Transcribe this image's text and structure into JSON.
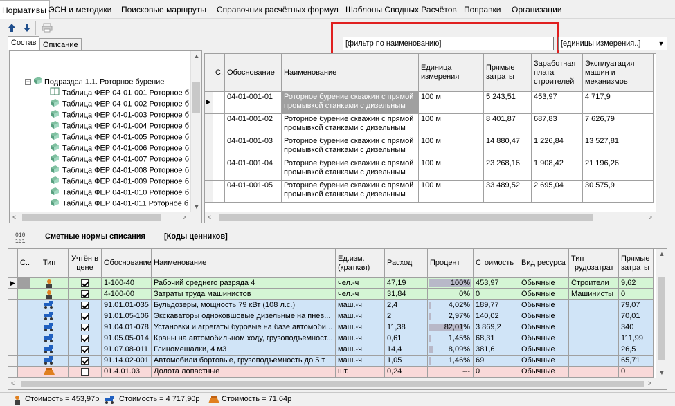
{
  "menu": {
    "tabs": [
      "Нормативы",
      "ЭСН и методики",
      "Поисковые маршруты",
      "Справочник расчётных формул",
      "Шаблоны Сводных Расчётов",
      "Поправки",
      "Организации"
    ]
  },
  "subtabs": [
    "Состав",
    "Описание"
  ],
  "filter": {
    "name_value": "[фильтр по наименованию]",
    "unit_value": "[единицы измерения..]"
  },
  "tree": {
    "root": "Подраздел 1.1. Роторное бурение",
    "items": [
      "Таблица ФЕР 04-01-001 Роторное б",
      "Таблица ФЕР 04-01-002 Роторное б",
      "Таблица ФЕР 04-01-003 Роторное б",
      "Таблица ФЕР 04-01-004 Роторное б",
      "Таблица ФЕР 04-01-005 Роторное б",
      "Таблица ФЕР 04-01-006 Роторное б",
      "Таблица ФЕР 04-01-007 Роторное б",
      "Таблица ФЕР 04-01-008 Роторное б",
      "Таблица ФЕР 04-01-009 Роторное б",
      "Таблица ФЕР 04-01-010 Роторное б",
      "Таблица ФЕР 04-01-011 Роторное б"
    ]
  },
  "upper_grid": {
    "headers": [
      "С..",
      "Обоснование",
      "Наименование",
      "Единица измерения",
      "Прямые затраты",
      "Заработная плата строителей",
      "Эксплуатация машин и механизмов"
    ],
    "rows": [
      {
        "code": "04-01-001-01",
        "name": "Роторное бурение скважин с прямой промывкой станками с дизельным",
        "unit": "100 м",
        "direct": "5 243,51",
        "salary": "453,97",
        "machines": "4 717,9"
      },
      {
        "code": "04-01-001-02",
        "name": "Роторное бурение скважин с прямой промывкой станками с дизельным",
        "unit": "100 м",
        "direct": "8 401,87",
        "salary": "687,83",
        "machines": "7 626,79"
      },
      {
        "code": "04-01-001-03",
        "name": "Роторное бурение скважин с прямой промывкой станками с дизельным",
        "unit": "100 м",
        "direct": "14 880,47",
        "salary": "1 226,84",
        "machines": "13 527,81"
      },
      {
        "code": "04-01-001-04",
        "name": "Роторное бурение скважин с прямой промывкой станками с дизельным",
        "unit": "100 м",
        "direct": "23 268,16",
        "salary": "1 908,42",
        "machines": "21 196,26"
      },
      {
        "code": "04-01-001-05",
        "name": "Роторное бурение скважин с прямой промывкой станками с дизельным",
        "unit": "100 м",
        "direct": "33 489,52",
        "salary": "2 695,04",
        "machines": "30 575,9"
      }
    ]
  },
  "lower_header": {
    "title": "Сметные нормы списания",
    "codes": "[Коды ценников]"
  },
  "lower_grid": {
    "headers": [
      "С..",
      "Тип",
      "Учтён в цене",
      "Обоснование",
      "Наименование",
      "Ед.изм. (краткая)",
      "Расход",
      "Процент",
      "Стоимость",
      "Вид ресурса",
      "Тип трудозатрат",
      "Прямые затраты"
    ],
    "rows": [
      {
        "icon": "worker",
        "checked": true,
        "code": "1-100-40",
        "name": "Рабочий среднего разряда 4",
        "unit": "чел.-ч",
        "rate": "47,19",
        "pct": "100%",
        "pct_fraction": 1.0,
        "cost": "453,97",
        "kind": "Обычные",
        "labor": "Строители",
        "direct": "9,62",
        "bg": "#d4f5d4"
      },
      {
        "icon": "worker",
        "checked": true,
        "code": "4-100-00",
        "name": "Затраты труда машинистов",
        "unit": "чел.-ч",
        "rate": "31,84",
        "pct": "0%",
        "pct_fraction": 0,
        "cost": "0",
        "kind": "Обычные",
        "labor": "Машинисты",
        "direct": "0",
        "bg": "#d4f5d4"
      },
      {
        "icon": "machine",
        "checked": true,
        "code": "91.01.01-035",
        "name": "Бульдозеры, мощность 79 кВт (108 л.с.)",
        "unit": "маш.-ч",
        "rate": "2,4",
        "pct": "4,02%",
        "pct_fraction": 0.0402,
        "cost": "189,77",
        "kind": "Обычные",
        "labor": "",
        "direct": "79,07",
        "bg": "#d0e4f7"
      },
      {
        "icon": "machine",
        "checked": true,
        "code": "91.01.05-106",
        "name": "Экскаваторы одноковшовые дизельные на пнев...",
        "unit": "маш.-ч",
        "rate": "2",
        "pct": "2,97%",
        "pct_fraction": 0.0297,
        "cost": "140,02",
        "kind": "Обычные",
        "labor": "",
        "direct": "70,01",
        "bg": "#d0e4f7"
      },
      {
        "icon": "machine",
        "checked": true,
        "code": "91.04.01-078",
        "name": "Установки и агрегаты буровые на базе автомоби...",
        "unit": "маш.-ч",
        "rate": "11,38",
        "pct": "82,01%",
        "pct_fraction": 0.8201,
        "cost": "3 869,2",
        "kind": "Обычные",
        "labor": "",
        "direct": "340",
        "bg": "#d0e4f7"
      },
      {
        "icon": "machine",
        "checked": true,
        "code": "91.05.05-014",
        "name": "Краны на автомобильном ходу, грузоподъемност...",
        "unit": "маш.-ч",
        "rate": "0,61",
        "pct": "1,45%",
        "pct_fraction": 0.0145,
        "cost": "68,31",
        "kind": "Обычные",
        "labor": "",
        "direct": "111,99",
        "bg": "#d0e4f7"
      },
      {
        "icon": "machine",
        "checked": true,
        "code": "91.07.08-011",
        "name": "Глиномешалки, 4 м3",
        "unit": "маш.-ч",
        "rate": "14,4",
        "pct": "8,09%",
        "pct_fraction": 0.0809,
        "cost": "381,6",
        "kind": "Обычные",
        "labor": "",
        "direct": "26,5",
        "bg": "#d0e4f7"
      },
      {
        "icon": "machine",
        "checked": true,
        "code": "91.14.02-001",
        "name": "Автомобили бортовые, грузоподъемность до 5 т",
        "unit": "маш.-ч",
        "rate": "1,05",
        "pct": "1,46%",
        "pct_fraction": 0.0146,
        "cost": "69",
        "kind": "Обычные",
        "labor": "",
        "direct": "65,71",
        "bg": "#d0e4f7"
      },
      {
        "icon": "material",
        "checked": false,
        "code": "01.4.01.03",
        "name": "Долота лопастные",
        "unit": "шт.",
        "rate": "0,24",
        "pct": "---",
        "pct_fraction": 0,
        "cost": "0",
        "kind": "Обычные",
        "labor": "",
        "direct": "0",
        "bg": "#f9d9d9"
      }
    ]
  },
  "status": {
    "worker_cost": "Стоимость = 453,97р",
    "machine_cost": "Стоимость = 4 717,90р",
    "material_cost": "Стоимость = 71,64р"
  },
  "colors": {
    "highlight_box": "#e02020",
    "labor_row": "#d4f5d4",
    "machine_row": "#d0e4f7",
    "material_row": "#f9d9d9"
  }
}
